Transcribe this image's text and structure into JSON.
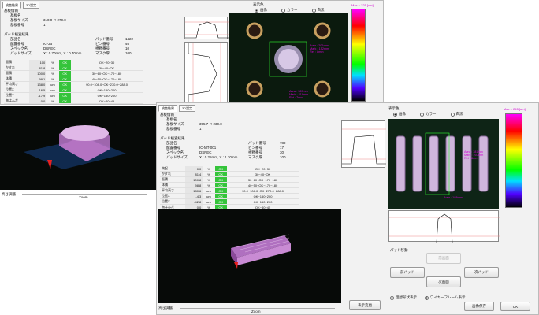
{
  "panel1": {
    "tabs": [
      "検査結果",
      "3D設定"
    ],
    "base_info_title": "基板情報",
    "base_name_label": "基板名",
    "base_size_label": "基板サイズ",
    "base_size_value": "310.0 ✕ 270.0",
    "base_num_label": "基板番号",
    "base_num_value": "1",
    "pad_result_title": "パッド検査結果",
    "part_label": "部品名",
    "pad_no_label": "パッド番号",
    "pad_no_value": "1422",
    "place_no_label": "配置番号",
    "place_no_value": "IC-JB",
    "pin_no_label": "ピン番号",
    "pin_no_value": "46",
    "spec_label": "スペック名",
    "spec_value": "DSPEC",
    "view_label": "視野番号",
    "view_value": "10",
    "pad_size_label": "パッドサイズ",
    "pad_size_value": "X : 0.70mm, Y : 0.70mm",
    "mask_label": "マスク厚",
    "mask_value": "100",
    "results": [
      {
        "name": "面積",
        "value": "100",
        "unit": "%",
        "status": "OK",
        "spec": "OK~20~30"
      },
      {
        "name": "かすれ",
        "value": "81.8",
        "unit": "%",
        "status": "OK",
        "spec": "30~40~OK"
      },
      {
        "name": "面積",
        "value": "100.0",
        "unit": "%",
        "status": "OK",
        "spec": "30~60~OK~170~180"
      },
      {
        "name": "体積",
        "value": "99.1",
        "unit": "%",
        "status": "OK",
        "spec": "40~50~OK~170~180"
      },
      {
        "name": "平均高さ",
        "value": "138.0",
        "unit": "um",
        "status": "OK",
        "spec": "90.0~108.0~OK~270.0~288.0"
      },
      {
        "name": "位置X",
        "value": "16.5",
        "unit": "um",
        "status": "OK",
        "spec": "OK~150~200"
      },
      {
        "name": "位置Y",
        "value": "-17.9",
        "unit": "um",
        "status": "OK",
        "spec": "OK~150~200"
      },
      {
        "name": "無はんだ",
        "value": "0.0",
        "unit": "%",
        "status": "OK",
        "spec": "OK~40~45"
      }
    ],
    "display_color_label": "表示色",
    "display_options": [
      "画像",
      "カラー",
      "白黒"
    ],
    "color_max_label": "Max = 225 [um]",
    "overlay_a": [
      "Area : 201mm",
      "Mark : 152mm",
      "Ret : 8mm"
    ],
    "overlay_b": [
      "Area : 189mm",
      "Mark : 218mm",
      "Ret : 7mm"
    ],
    "height_adjust_label": "高さ調整",
    "zoom_label": "Zoom"
  },
  "panel2": {
    "tabs": [
      "検査結果",
      "3D設定"
    ],
    "base_info_title": "基板情報",
    "base_name_label": "基板名",
    "base_size_label": "基板サイズ",
    "base_size_value": "395.7 ✕ 230.0",
    "base_num_label": "基板番号",
    "base_num_value": "1",
    "pad_result_title": "パッド検査結果",
    "part_label": "部品名",
    "pad_no_label": "パッド番号",
    "pad_no_value": "789",
    "place_no_label": "配置番号",
    "place_no_value": "IC-MT-001",
    "pin_no_label": "ピン番号",
    "pin_no_value": "17",
    "spec_label": "スペック名",
    "spec_value": "DSPEC",
    "view_label": "視野番号",
    "view_value": "30",
    "pad_size_label": "パッドサイズ",
    "pad_size_value": "X : 0.25mm, Y : 1.30mm",
    "mask_label": "マスク厚",
    "mask_value": "100",
    "results": [
      {
        "name": "突起",
        "value": "0.0",
        "unit": "%",
        "status": "OK",
        "spec": "OK~20~30"
      },
      {
        "name": "かすれ",
        "value": "81.4",
        "unit": "%",
        "status": "OK",
        "spec": "30~40~OK"
      },
      {
        "name": "面積",
        "value": "100.8",
        "unit": "%",
        "status": "OK",
        "spec": "30~60~OK~170~180"
      },
      {
        "name": "体積",
        "value": "98.8",
        "unit": "%",
        "status": "OK",
        "spec": "40~50~OK~170~180"
      },
      {
        "name": "平均高さ",
        "value": "180.6",
        "unit": "um",
        "status": "OK",
        "spec": "90.0~108.0~OK~270.0~288.0"
      },
      {
        "name": "位置X",
        "value": "-4.3",
        "unit": "um",
        "status": "OK",
        "spec": "OK~150~200"
      },
      {
        "name": "位置Y",
        "value": "-42.8",
        "unit": "um",
        "status": "OK",
        "spec": "OK~150~200"
      },
      {
        "name": "無はんだ",
        "value": "0.0",
        "unit": "%",
        "status": "OK",
        "spec": "OK~40~45"
      }
    ],
    "display_color_label": "表示色",
    "display_options": [
      "画像",
      "カラー",
      "白黒"
    ],
    "color_max_label": "Max = 245 [um]",
    "overlay": [
      "Area : 181mm",
      "Mark : 207mm",
      "Ret : 6mm",
      "Area : 188mm"
    ],
    "pad_move_label": "パッド移動",
    "prev_screen_label": "前画面",
    "prev_pad_label": "前パッド",
    "next_pad_label": "次パッド",
    "next_screen_label": "次画面",
    "ideal_shape_label": "理想形状表示",
    "wireframe_label": "ワイヤーフレーム表示",
    "height_adjust_label": "高さ調整",
    "zoom_label": "Zoom",
    "display_change_label": "表示変更",
    "save_image_label": "画像保存",
    "ok_label": "OK"
  },
  "colors": {
    "ok_green": "#35c43b",
    "overlay_magenta": "#d000d0",
    "roi_green": "#33ff33",
    "surface_pink": "#d8a0e0"
  }
}
